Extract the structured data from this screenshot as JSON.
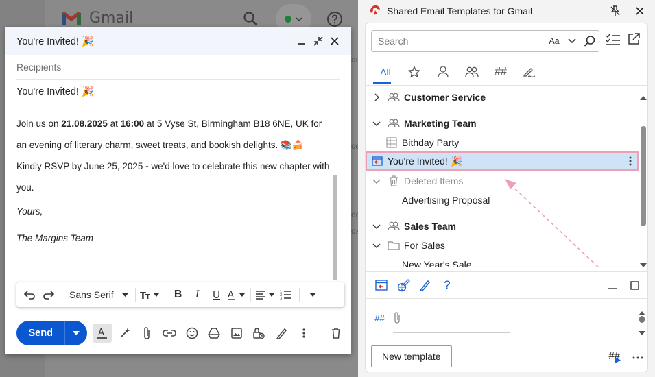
{
  "gmail": {
    "wordmark": "Gmail",
    "hints": [
      "ac",
      "ce",
      "og",
      "ox"
    ]
  },
  "compose": {
    "title": "You're Invited! 🎉",
    "recipients_placeholder": "Recipients",
    "subject": "You're Invited! 🎉",
    "body": {
      "line1_pre": "Join us on ",
      "line1_date": "21.08.2025",
      "line1_mid": " at ",
      "line1_time": "16:00",
      "line1_post": " at  5 Vyse St, Birmingham B18 6NE, UK for",
      "line2": "an evening of literary charm, sweet treats, and bookish delights. 📚🍰",
      "line3_pre": "Kindly RSVP by June 25, 2025 ",
      "line3_dash": "-",
      "line3_post": " we'd love to celebrate this new chapter with",
      "line4": "you.",
      "closing": "Yours,",
      "signature": "The Margins Team"
    },
    "formatting": {
      "font": "Sans Serif"
    },
    "send_label": "Send"
  },
  "panel": {
    "title": "Shared Email Templates for Gmail",
    "search_placeholder": "Search",
    "match_case_label": "Aa",
    "tabs": [
      {
        "label": "All",
        "icon": "text-label"
      },
      {
        "label": "",
        "icon": "star-icon"
      },
      {
        "label": "",
        "icon": "person-icon"
      },
      {
        "label": "",
        "icon": "people-icon"
      },
      {
        "label": "##",
        "icon": "hash-icon"
      },
      {
        "label": "",
        "icon": "edit-icon"
      }
    ],
    "tree": [
      {
        "label": "Customer Service",
        "type": "team",
        "expanded": false,
        "bold": true
      },
      {
        "label": "Marketing Team",
        "type": "team",
        "expanded": true,
        "bold": true
      },
      {
        "label": "Bithday Party",
        "type": "template-table"
      },
      {
        "label": "You're Invited! 🎉",
        "type": "template-selected",
        "selected": true
      },
      {
        "label": "Deleted Items",
        "type": "trash",
        "expanded": true
      },
      {
        "label": "Advertising Proposal",
        "type": "template"
      },
      {
        "label": "Sales Team",
        "type": "team",
        "expanded": true,
        "bold": true
      },
      {
        "label": "For Sales",
        "type": "folder",
        "expanded": true
      },
      {
        "label": "New Year's Sale",
        "type": "template"
      }
    ],
    "tags_hash": "##",
    "new_template_label": "New template",
    "footer_hash": "##",
    "accent_color": "#1a62d6",
    "selected_border_color": "#ef9fb5"
  }
}
